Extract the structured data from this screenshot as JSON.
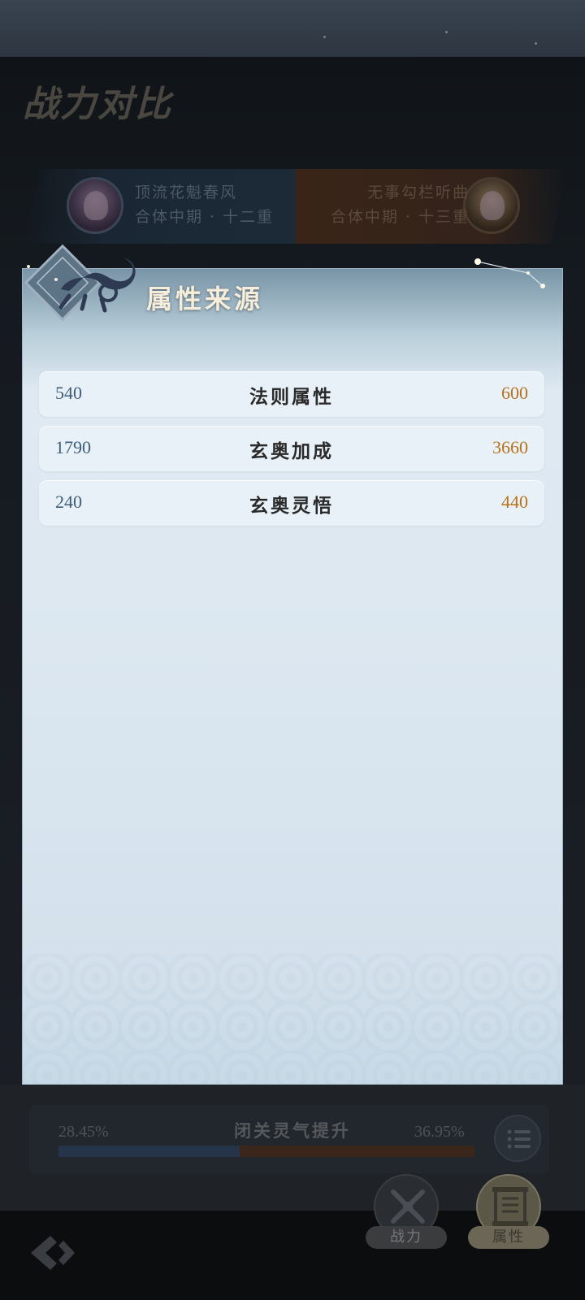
{
  "page": {
    "title": "战力对比"
  },
  "versus": {
    "left": {
      "name": "顶流花魁春风",
      "realm": "合体中期 · 十二重"
    },
    "right": {
      "name": "无事勾栏听曲",
      "realm": "合体中期 · 十三重"
    }
  },
  "panel": {
    "title": "属性来源",
    "rows": [
      {
        "left": "540",
        "label": "法则属性",
        "right": "600"
      },
      {
        "left": "1790",
        "label": "玄奥加成",
        "right": "3660"
      },
      {
        "left": "240",
        "label": "玄奥灵悟",
        "right": "440"
      }
    ]
  },
  "progress": {
    "title": "闭关灵气提升",
    "left_value": "28.45%",
    "right_value": "36.95%",
    "left_share": 0.435
  },
  "nav": {
    "items": [
      {
        "label": "战力",
        "icon": "crossed-swords-icon",
        "active": false
      },
      {
        "label": "属性",
        "icon": "scroll-icon",
        "active": true
      }
    ]
  },
  "colors": {
    "left_value": "#3f5d78",
    "right_value": "#b8721a",
    "panel_title": "#f6eeda"
  }
}
